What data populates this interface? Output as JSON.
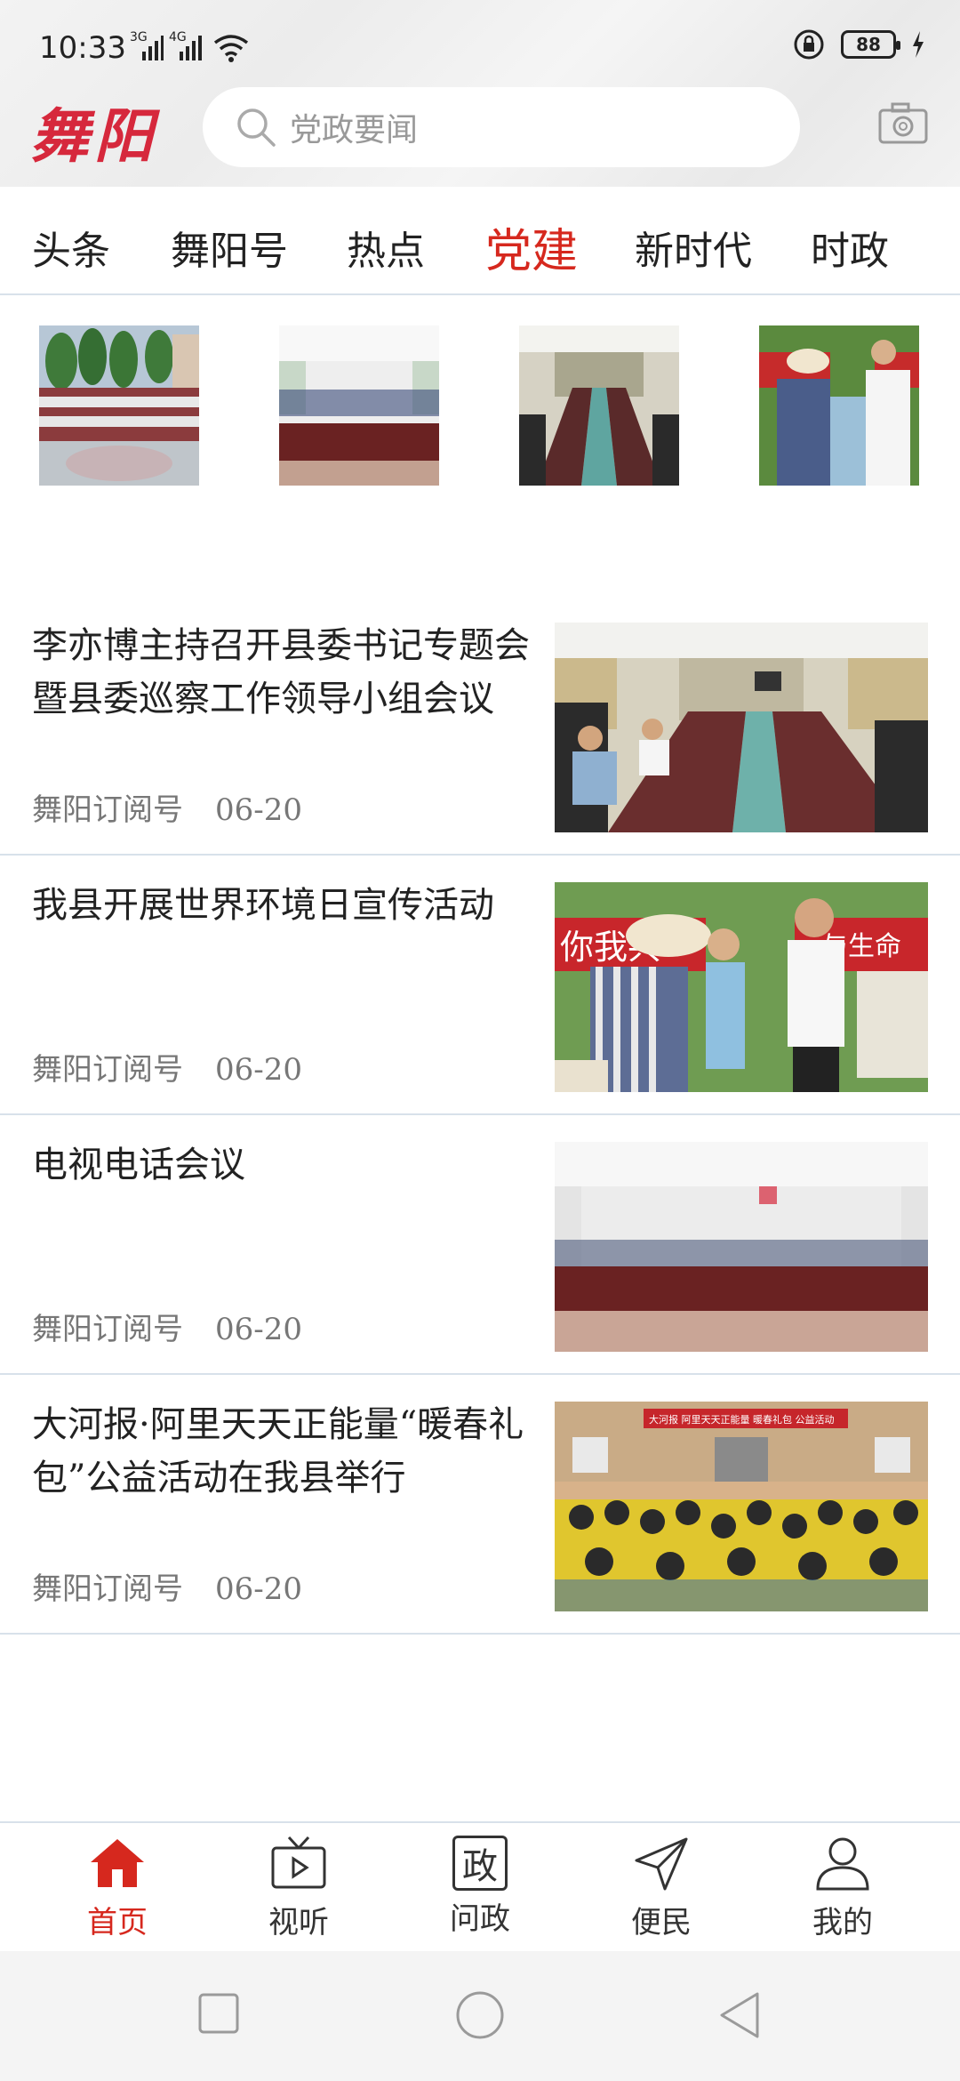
{
  "status": {
    "time": "10:33",
    "signal1": "3G",
    "signal2": "4G",
    "battery": "88"
  },
  "header": {
    "logo": "舞阳",
    "search_placeholder": "党政要闻"
  },
  "tabs": [
    {
      "label": "头条"
    },
    {
      "label": "舞阳号"
    },
    {
      "label": "热点"
    },
    {
      "label": "党建"
    },
    {
      "label": "新时代"
    },
    {
      "label": "时政"
    }
  ],
  "active_tab": "党建",
  "news": [
    {
      "title": "李亦博主持召开县委书记专题会暨县委巡察工作领导小组会议",
      "source": "舞阳订阅号",
      "date": "06-20"
    },
    {
      "title": "我县开展世界环境日宣传活动",
      "source": "舞阳订阅号",
      "date": "06-20"
    },
    {
      "title": "电视电话会议",
      "source": "舞阳订阅号",
      "date": "06-20"
    },
    {
      "title": "大河报·阿里天天正能量“暖春礼包”公益活动在我县举行",
      "source": "舞阳订阅号",
      "date": "06-20"
    }
  ],
  "image_texts": {
    "banner_left": "你我共",
    "banner_right": "与生命",
    "school_banner": "大河报 阿里天天正能量 暖春礼包 公益活动"
  },
  "bottom_nav": [
    {
      "label": "首页"
    },
    {
      "label": "视听"
    },
    {
      "label": "问政",
      "icon_text": "政"
    },
    {
      "label": "便民"
    },
    {
      "label": "我的"
    }
  ],
  "colors": {
    "accent": "#d6281e",
    "divider": "#d8e1ea"
  }
}
